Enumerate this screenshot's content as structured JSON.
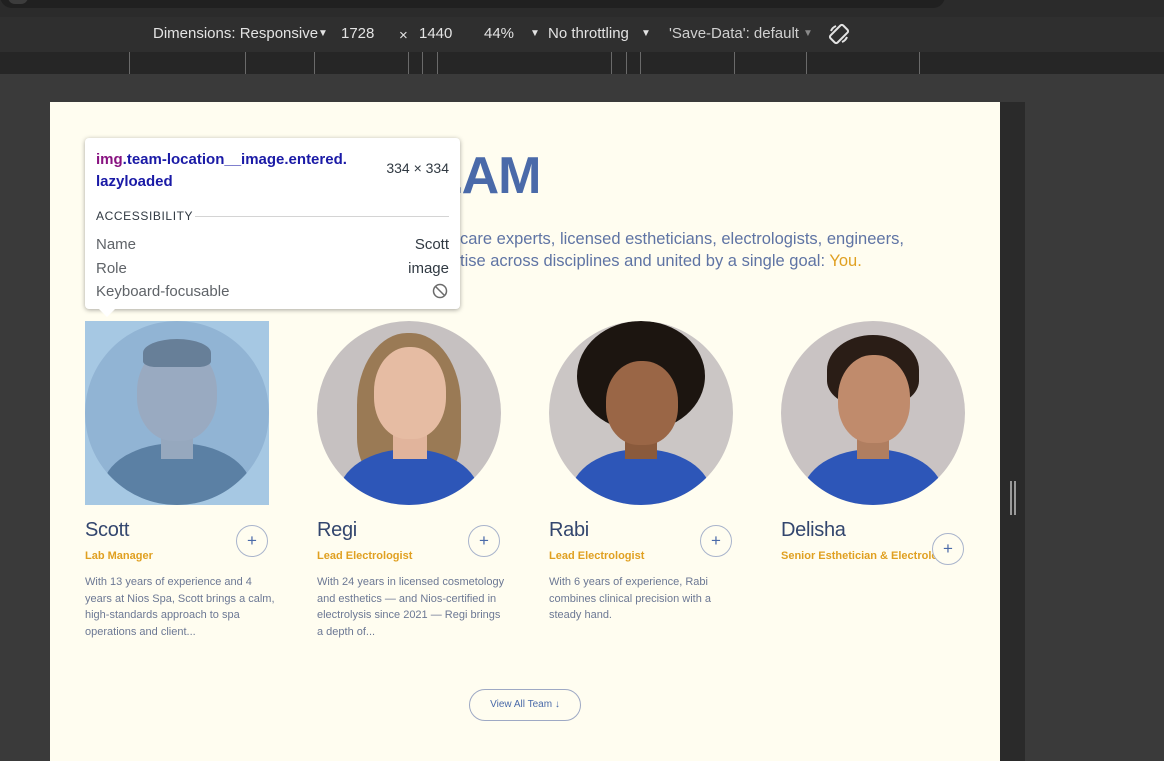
{
  "devtools": {
    "dimensions_label": "Dimensions: Responsive",
    "width": "1728",
    "times": "×",
    "height": "1440",
    "zoom": "44%",
    "throttling": "No throttling",
    "save_data": "'Save-Data': default"
  },
  "page": {
    "headline": "E TEAM",
    "intro_line1": "care experts, licensed estheticians, electrologists, engineers,",
    "intro_line2": "tise across disciplines and united by a single goal: ",
    "intro_accent": "You.",
    "members": [
      {
        "name": "Scott",
        "role": "Lab Manager",
        "bio": "With 13 years of experience and 4 years at Nios Spa, Scott brings a calm, high-standards approach to spa operations and client..."
      },
      {
        "name": "Regi",
        "role": "Lead Electrologist",
        "bio": "With 24 years in licensed cosmetology and esthetics — and Nios-certified in electrolysis since 2021 — Regi brings a depth of..."
      },
      {
        "name": "Rabi",
        "role": "Lead Electrologist",
        "bio": "With 6 years of experience, Rabi combines clinical precision with a steady hand."
      },
      {
        "name": "Delisha",
        "role": "Senior Esthetician & Electrologist",
        "bio": ""
      }
    ],
    "plus_symbol": "+",
    "view_all": "View All Team ↓"
  },
  "inspector": {
    "tag": "img",
    "classes": ".team-location__image.entered.",
    "classes2": "lazyloaded",
    "dimensions": "334 × 334",
    "section": "ACCESSIBILITY",
    "rows": [
      {
        "label": "Name",
        "value": "Scott"
      },
      {
        "label": "Role",
        "value": "image"
      },
      {
        "label": "Keyboard-focusable",
        "value": ""
      }
    ]
  }
}
